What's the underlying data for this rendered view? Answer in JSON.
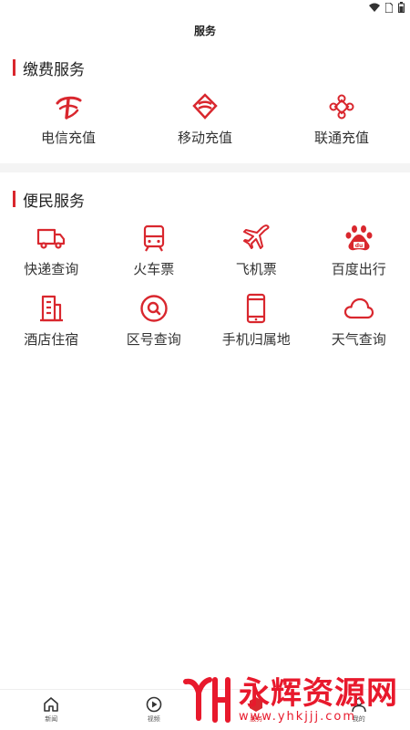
{
  "header": {
    "title": "服务"
  },
  "sections": [
    {
      "title": "缴费服务",
      "items": [
        {
          "label": "电信充值",
          "icon": "telecom-icon"
        },
        {
          "label": "移动充值",
          "icon": "mobile-icon"
        },
        {
          "label": "联通充值",
          "icon": "unicom-icon"
        }
      ]
    },
    {
      "title": "便民服务",
      "items": [
        {
          "label": "快递查询",
          "icon": "truck-icon"
        },
        {
          "label": "火车票",
          "icon": "train-icon"
        },
        {
          "label": "飞机票",
          "icon": "plane-icon"
        },
        {
          "label": "百度出行",
          "icon": "baidu-icon"
        },
        {
          "label": "酒店住宿",
          "icon": "hotel-icon"
        },
        {
          "label": "区号查询",
          "icon": "search-icon"
        },
        {
          "label": "手机归属地",
          "icon": "phone-icon"
        },
        {
          "label": "天气查询",
          "icon": "cloud-icon"
        }
      ]
    }
  ],
  "bottom_nav": [
    {
      "label": "新闻",
      "icon": "home-icon"
    },
    {
      "label": "视频",
      "icon": "play-icon"
    },
    {
      "label": "服务",
      "icon": "service-icon",
      "active": true
    },
    {
      "label": "我的",
      "icon": "user-icon"
    }
  ],
  "watermark": {
    "title": "永辉资源网",
    "url": "www.yhkjjj.com"
  },
  "colors": {
    "accent": "#d9272e",
    "divider": "#f4f4f4"
  }
}
